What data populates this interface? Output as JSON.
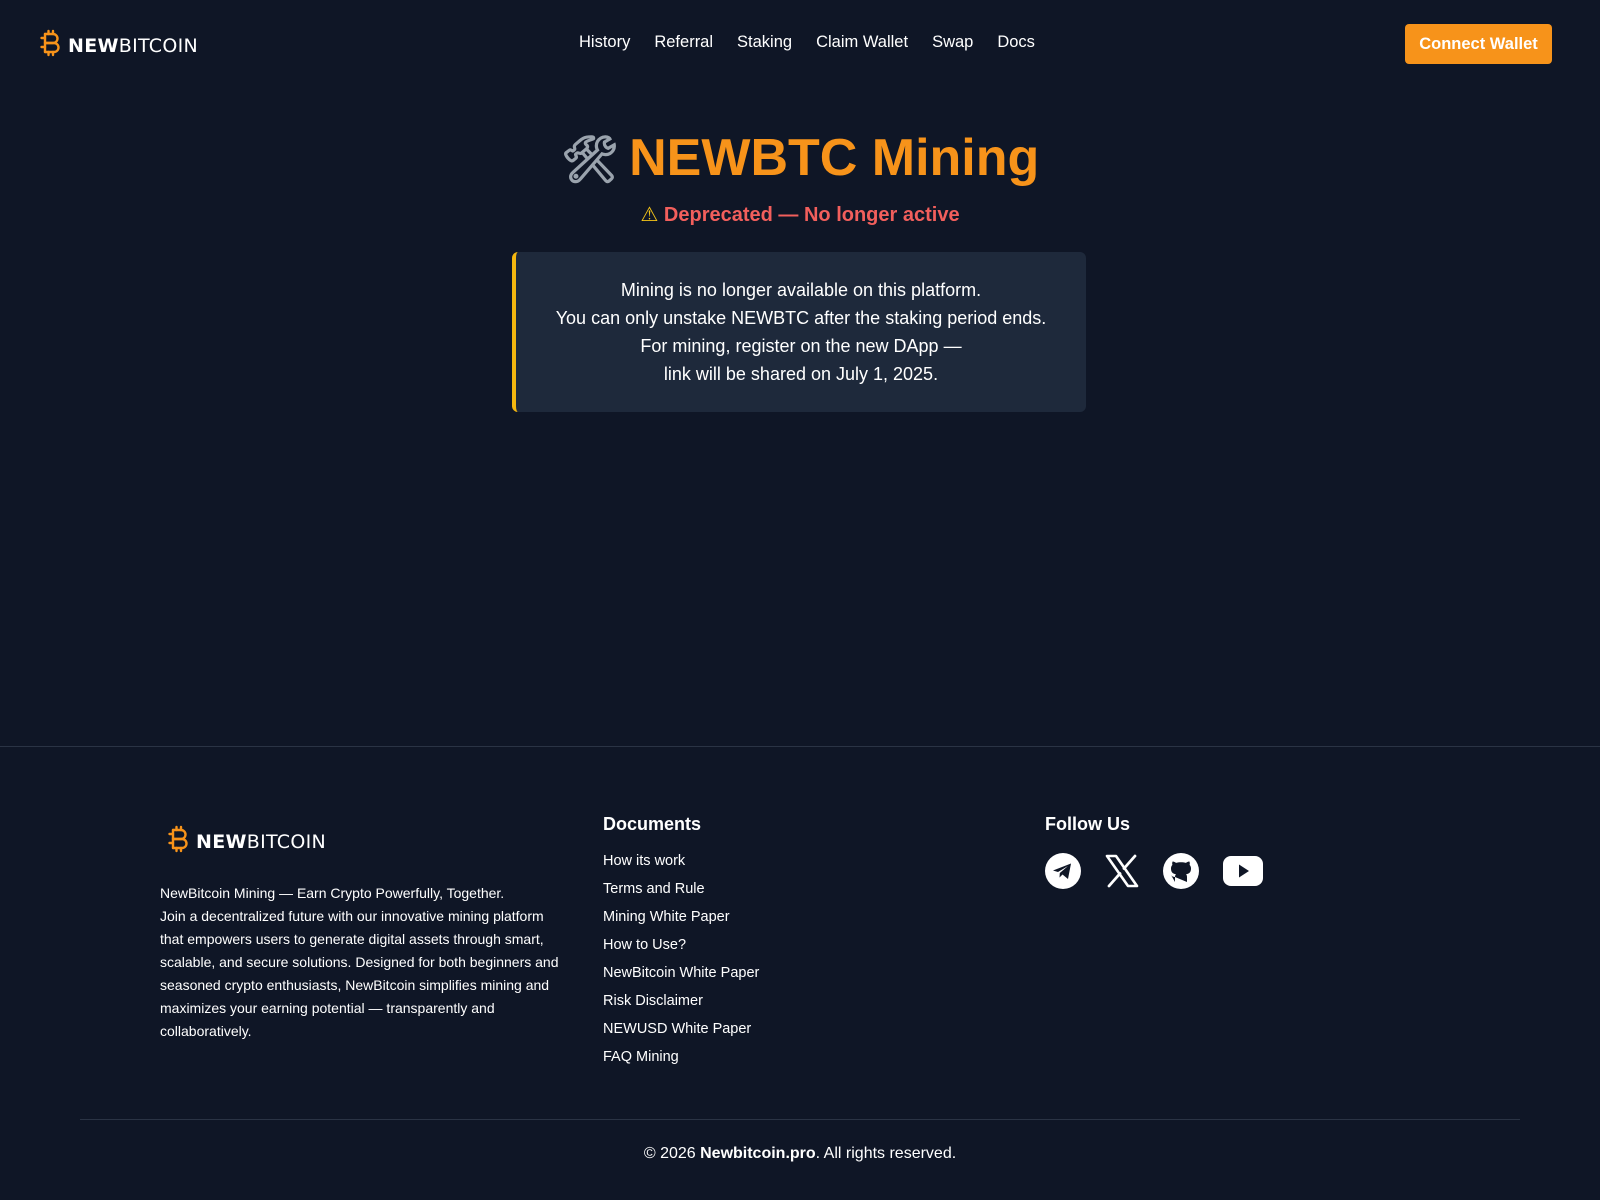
{
  "brand": {
    "name_bold": "NEW",
    "name_rest": "BITCOIN"
  },
  "nav": {
    "items": [
      "History",
      "Referral",
      "Staking",
      "Claim Wallet",
      "Swap",
      "Docs"
    ],
    "connect_label": "Connect Wallet"
  },
  "hero": {
    "icon": "hammer-and-wrench-icon",
    "title": "NEWBTC Mining",
    "status_icon": "warning-icon",
    "status": "Deprecated — No longer active"
  },
  "notice": {
    "lines": [
      "Mining is no longer available on this platform.",
      "You can only unstake NEWBTC after the staking period ends.",
      "For mining, register on the new DApp —",
      "link will be shared on July 1, 2025."
    ]
  },
  "footer": {
    "tagline": "NewBitcoin Mining — Earn Crypto Powerfully, Together.",
    "about": "Join a decentralized future with our innovative mining platform that empowers users to generate digital assets through smart, scalable, and secure solutions. Designed for both beginners and seasoned crypto enthusiasts, NewBitcoin simplifies mining and maximizes your earning potential — transparently and collaboratively.",
    "documents_heading": "Documents",
    "documents": [
      "How its work",
      "Terms and Rule",
      "Mining White Paper",
      "How to Use?",
      "NewBitcoin White Paper",
      "Risk Disclaimer",
      "NEWUSD White Paper",
      "FAQ Mining"
    ],
    "follow_heading": "Follow Us",
    "socials": [
      "telegram-icon",
      "x-icon",
      "github-icon",
      "youtube-icon"
    ],
    "copyright_prefix": "© 2026 ",
    "copyright_site": "Newbitcoin.pro",
    "copyright_suffix": ". All rights reserved."
  },
  "colors": {
    "background": "#0f1626",
    "accent": "#f7931a",
    "danger": "#f25f5c",
    "card": "#1e293b",
    "card_border": "#f5b70f"
  }
}
